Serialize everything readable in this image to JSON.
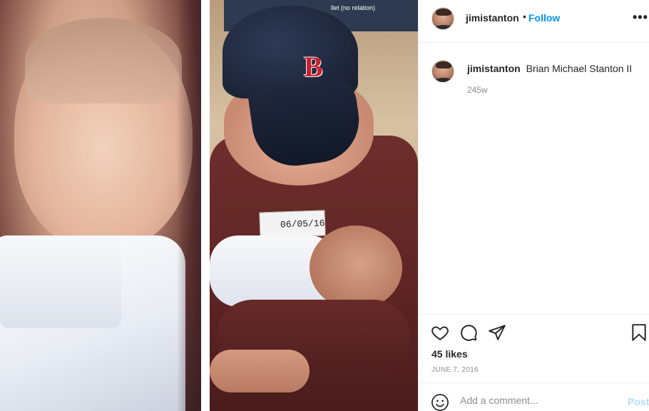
{
  "post": {
    "username": "jimistanton",
    "follow_label": "Follow",
    "dot": "•",
    "more_label": "•••",
    "caption": {
      "username": "jimistanton",
      "text": "Brian Michael Stanton II",
      "time_ago": "245w"
    },
    "likes": "45 likes",
    "date": "JUNE 7, 2016",
    "comment_placeholder": "Add a comment...",
    "post_label": "Post"
  },
  "photo": {
    "tv_text": "llet (no relation)",
    "tag_text": "06/05/16",
    "cap_logo": "B"
  },
  "icons": {
    "like": "heart-icon",
    "comment": "speech-bubble-icon",
    "share": "paper-plane-icon",
    "save": "bookmark-icon",
    "emoji": "smiley-icon",
    "more": "ellipsis-icon"
  },
  "colors": {
    "accent": "#0095f6",
    "post_disabled": "#b2dffc",
    "muted": "#8e8e8e",
    "text": "#262626",
    "cap_logo": "#c8202f"
  }
}
